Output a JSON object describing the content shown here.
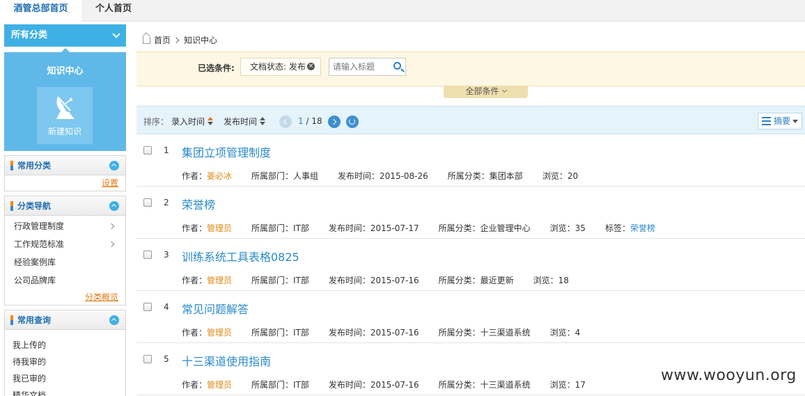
{
  "tabs": [
    {
      "label": "酒管总部首页",
      "active": true
    },
    {
      "label": "个人首页",
      "active": false
    }
  ],
  "sidebar": {
    "all_categories": "所有分类",
    "knowledge_center": "知识中心",
    "new_knowledge": "新建知识",
    "common_categories": {
      "title": "常用分类",
      "link": "设置"
    },
    "category_nav": {
      "title": "分类导航",
      "items": [
        {
          "label": "行政管理制度",
          "has_children": true
        },
        {
          "label": "工作规范标准",
          "has_children": true
        },
        {
          "label": "经验案例库",
          "has_children": false
        },
        {
          "label": "公司品牌库",
          "has_children": false
        }
      ],
      "link": "分类概览"
    },
    "common_queries": {
      "title": "常用查询",
      "items": [
        "我上传的",
        "待我审的",
        "我已审的",
        "精华文档"
      ]
    }
  },
  "breadcrumb": {
    "home": "首页",
    "current": "知识中心"
  },
  "filter": {
    "label": "已选条件:",
    "chip": "文档状态: 发布",
    "search_placeholder": "请输入标题",
    "all_conditions": "全部条件"
  },
  "sortbar": {
    "label": "排序：",
    "sort1": "录入时间",
    "sort2": "发布时间",
    "page_current": "1",
    "page_total": "18",
    "view_mode": "摘要"
  },
  "documents": [
    {
      "num": "1",
      "title": "集团立项管理制度",
      "author_label": "作者：",
      "author": "姜必冰",
      "dept": "所属部门：人事组",
      "date": "发布时间：2015-08-26",
      "category": "所属分类：集团本部",
      "views": "浏览：20"
    },
    {
      "num": "2",
      "title": "荣誉榜",
      "author_label": "作者：",
      "author": "管理员",
      "dept": "所属部门：IT部",
      "date": "发布时间：2015-07-17",
      "category": "所属分类：企业管理中心",
      "views": "浏览：35",
      "tag_label": "标签：",
      "tag": "荣誉榜"
    },
    {
      "num": "3",
      "title": "训练系统工具表格0825",
      "author_label": "作者：",
      "author": "管理员",
      "dept": "所属部门：IT部",
      "date": "发布时间：2015-07-16",
      "category": "所属分类：最近更新",
      "views": "浏览：18"
    },
    {
      "num": "4",
      "title": "常见问题解答",
      "author_label": "作者：",
      "author": "管理员",
      "dept": "所属部门：IT部",
      "date": "发布时间：2015-07-16",
      "category": "所属分类：十三渠道系统",
      "views": "浏览：4"
    },
    {
      "num": "5",
      "title": "十三渠道使用指南",
      "author_label": "作者：",
      "author": "管理员",
      "dept": "所属部门：IT部",
      "date": "发布时间：2015-07-16",
      "category": "所属分类：十三渠道系统",
      "views": "浏览：17"
    }
  ],
  "watermark": "www.wooyun.org",
  "colors": {
    "accent": "#3fb0e4",
    "link": "#2a8ac8",
    "author": "#e08a14"
  }
}
